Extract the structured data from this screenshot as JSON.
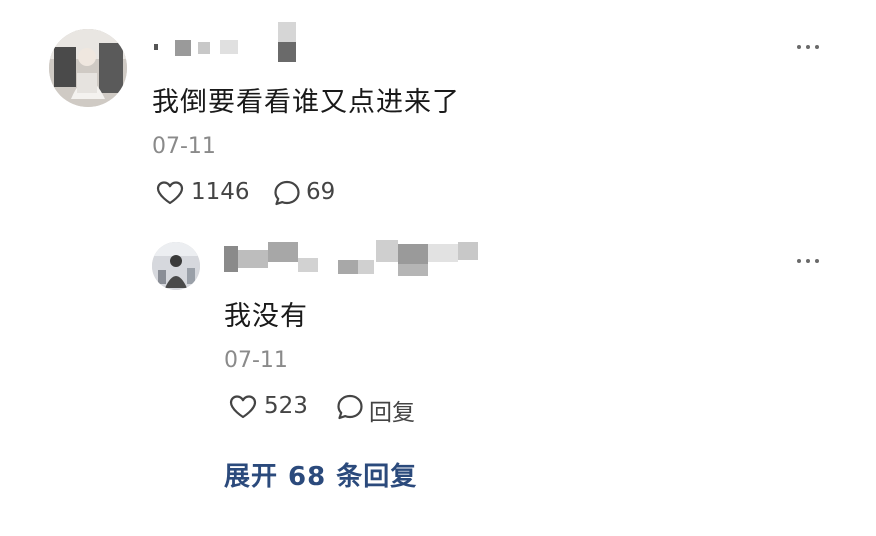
{
  "comment": {
    "text": "我倒要看看谁又点进来了",
    "date": "07-11",
    "likes": "1146",
    "replies": "69",
    "icons": {
      "like": "heart-outline-icon",
      "reply": "speech-bubble-icon",
      "more": "more-dots-icon"
    }
  },
  "reply": {
    "text": "我没有",
    "date": "07-11",
    "likes": "523",
    "reply_label": "回复"
  },
  "expand_label": "展开 68 条回复",
  "colors": {
    "expand_link": "#2b4a7c",
    "muted": "#8a8a8a",
    "text": "#1a1a1a"
  }
}
